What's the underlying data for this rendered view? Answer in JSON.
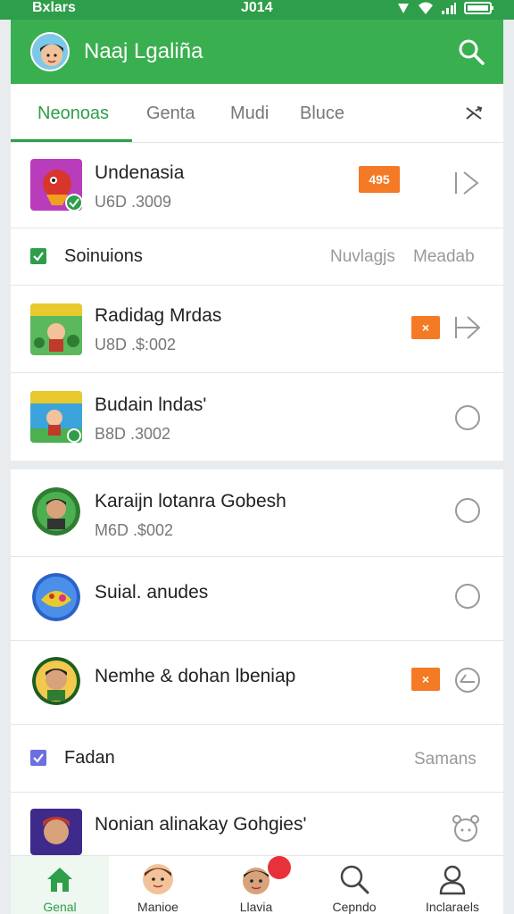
{
  "status_bar": {
    "carrier": "Bxlars",
    "time": "J014"
  },
  "app_bar": {
    "title": "Naaj Lgaliña"
  },
  "tabs": [
    {
      "label": "Neonoas",
      "active": true
    },
    {
      "label": "Genta",
      "active": false
    },
    {
      "label": "Mudi",
      "active": false
    },
    {
      "label": "Bluce",
      "active": false
    }
  ],
  "list1": [
    {
      "name": "Undenasia",
      "sub": "U6D .3009",
      "badge": "495"
    },
    {
      "section": "Soinuions",
      "right1": "Nuvlagjs",
      "right2": "Meadab"
    },
    {
      "name": "Radidag Mrdas",
      "sub": "U8D .$:002",
      "badge": "×"
    },
    {
      "name": "Budain lndas'",
      "sub": "B8D .3002"
    }
  ],
  "list2": [
    {
      "name": "Karaijn lotanra Gobesh",
      "sub": "M6D .$002"
    },
    {
      "name": "Suial. anudes"
    },
    {
      "name": "Nemhe & dohan lbeniap",
      "badge": "×"
    },
    {
      "section": "Fadan",
      "right": "Samans"
    },
    {
      "name": "Nonian alinakay Gohgies'"
    }
  ],
  "bottom_nav": [
    {
      "label": "Genal",
      "active": true
    },
    {
      "label": "Manioe",
      "active": false
    },
    {
      "label": "Llavia",
      "active": false
    },
    {
      "label": "Cepndo",
      "active": false
    },
    {
      "label": "Inclaraels",
      "active": false
    }
  ],
  "colors": {
    "primary": "#3aaf50",
    "accent": "#f47a25",
    "notification": "#e8323a",
    "section_check_blue": "#6b6fe0"
  }
}
